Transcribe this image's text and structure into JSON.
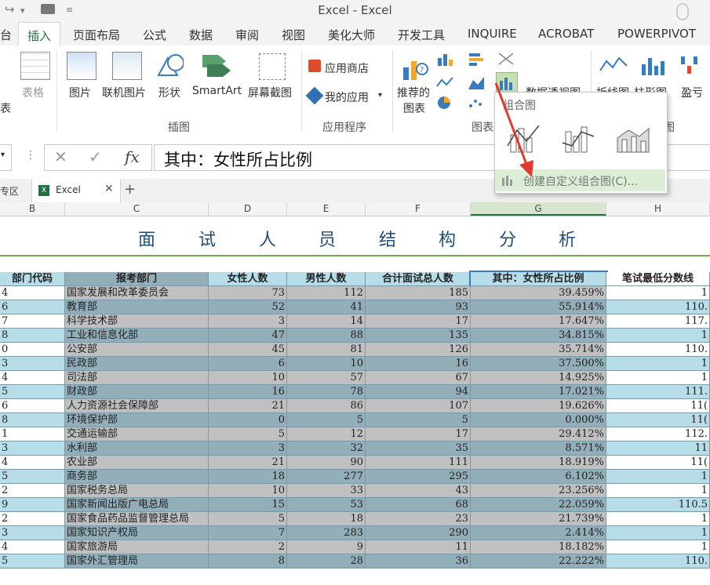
{
  "window": {
    "title": "Excel - Excel"
  },
  "ribbon_tabs": [
    "台",
    "插入",
    "页面布局",
    "公式",
    "数据",
    "审阅",
    "视图",
    "美化大师",
    "开发工具",
    "INQUIRE",
    "ACROBAT",
    "POWERPIVOT"
  ],
  "ribbon": {
    "table_partial": "表",
    "table_label": "表格",
    "picture": "图片",
    "online_picture": "联机图片",
    "shapes": "形状",
    "smartart": "SmartArt",
    "screenshot": "屏幕截图",
    "group_illustrations": "插图",
    "app_store": "应用商店",
    "my_apps": "我的应用",
    "group_apps": "应用程序",
    "recommended_charts_1": "推荐的",
    "recommended_charts_2": "图表",
    "pivot_chart": "数据透视图",
    "group_charts": "图表",
    "sparkline_line": "折线图",
    "sparkline_column": "柱形图",
    "sparkline_winloss": "盈亏",
    "group_partial": "图"
  },
  "combo_menu": {
    "title": "组合图",
    "custom": "创建自定义组合图(C)..."
  },
  "formula_bar": {
    "fx": "fx",
    "content": "其中：女性所占比例"
  },
  "sheet_tabs": {
    "left_partial": "专区",
    "workbook": "Excel"
  },
  "columns": [
    "B",
    "C",
    "D",
    "E",
    "F",
    "G",
    "H"
  ],
  "sheet_title": [
    "面",
    "试",
    "人",
    "员",
    "结",
    "构",
    "分",
    "析"
  ],
  "table": {
    "headers": [
      "部门代码",
      "报考部门",
      "女性人数",
      "男性人数",
      "合计面试总人数",
      "其中：女性所占比例",
      "笔试最低分数线"
    ],
    "rows": [
      [
        "4",
        "国家发展和改革委员会",
        "73",
        "112",
        "185",
        "39.459%",
        "1"
      ],
      [
        "6",
        "教育部",
        "52",
        "41",
        "93",
        "55.914%",
        "110."
      ],
      [
        "7",
        "科学技术部",
        "3",
        "14",
        "17",
        "17.647%",
        "117."
      ],
      [
        "8",
        "工业和信息化部",
        "47",
        "88",
        "135",
        "34.815%",
        "1"
      ],
      [
        "0",
        "公安部",
        "45",
        "81",
        "126",
        "35.714%",
        "110."
      ],
      [
        "3",
        "民政部",
        "6",
        "10",
        "16",
        "37.500%",
        "1"
      ],
      [
        "4",
        "司法部",
        "10",
        "57",
        "67",
        "14.925%",
        "1"
      ],
      [
        "5",
        "财政部",
        "16",
        "78",
        "94",
        "17.021%",
        "111."
      ],
      [
        "6",
        "人力资源社会保障部",
        "21",
        "86",
        "107",
        "19.626%",
        "11("
      ],
      [
        "8",
        "环境保护部",
        "0",
        "5",
        "5",
        "0.000%",
        "11("
      ],
      [
        "1",
        "交通运输部",
        "5",
        "12",
        "17",
        "29.412%",
        "112."
      ],
      [
        "3",
        "水利部",
        "3",
        "32",
        "35",
        "8.571%",
        "11"
      ],
      [
        "4",
        "农业部",
        "21",
        "90",
        "111",
        "18.919%",
        "11("
      ],
      [
        "5",
        "商务部",
        "18",
        "277",
        "295",
        "6.102%",
        "1"
      ],
      [
        "2",
        "国家税务总局",
        "10",
        "33",
        "43",
        "23.256%",
        "1"
      ],
      [
        "9",
        "国家新闻出版广电总局",
        "15",
        "53",
        "68",
        "22.059%",
        "110.5"
      ],
      [
        "2",
        "国家食品药品监督管理总局",
        "5",
        "18",
        "23",
        "21.739%",
        "1"
      ],
      [
        "3",
        "国家知识产权局",
        "7",
        "283",
        "290",
        "2.414%",
        "1"
      ],
      [
        "4",
        "国家旅游局",
        "2",
        "9",
        "11",
        "18.182%",
        "1"
      ],
      [
        "5",
        "国家外汇管理局",
        "8",
        "28",
        "36",
        "22.222%",
        "110."
      ]
    ]
  },
  "colors": {
    "accent": "#217346",
    "row_light": "#b7dde8",
    "row_dark": "#92aeb9",
    "row_grey": "#c0c0c0",
    "arrow": "#e03a2f"
  }
}
